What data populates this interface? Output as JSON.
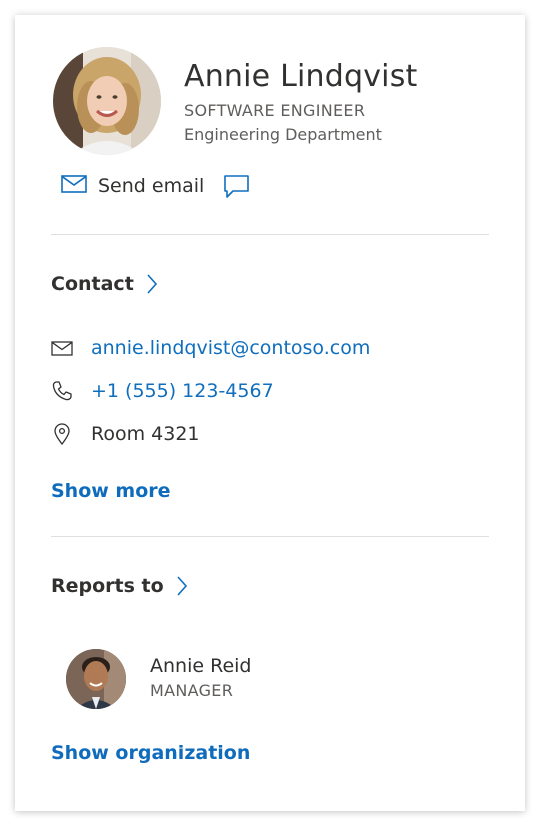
{
  "profile": {
    "name": "Annie Lindqvist",
    "job_title": "SOFTWARE ENGINEER",
    "department": "Engineering Department",
    "avatar_icon": "person-photo-woman",
    "actions": {
      "send_email_label": "Send email",
      "send_email_icon": "mail-icon",
      "chat_icon": "chat-bubble-icon"
    }
  },
  "contact": {
    "title": "Contact",
    "email": "annie.lindqvist@contoso.com",
    "phone": "+1 (555) 123-4567",
    "location": "Room 4321",
    "show_more": "Show more"
  },
  "reports_to": {
    "title": "Reports to",
    "manager": {
      "name": "Annie Reid",
      "title": "MANAGER",
      "avatar_icon": "person-photo-man"
    },
    "show_organization": "Show organization"
  },
  "colors": {
    "link": "#106ebe",
    "text": "#323130",
    "secondary_text": "#605e5c",
    "divider": "#e1dfdd"
  }
}
